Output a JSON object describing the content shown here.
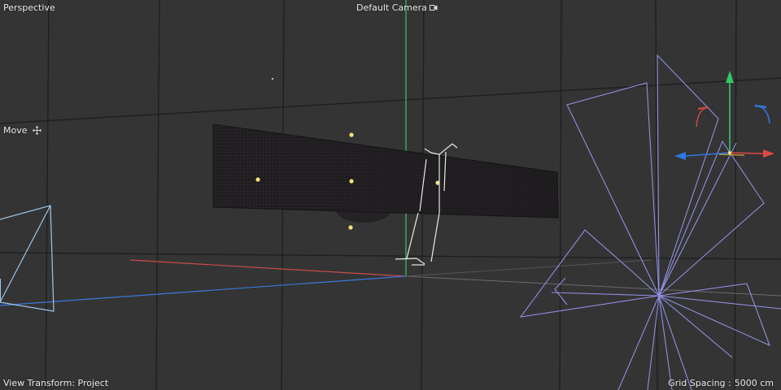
{
  "viewport": {
    "view_name": "Perspective",
    "camera": {
      "label": "Default Camera",
      "icon": "camera-switch-icon"
    },
    "active_tool": {
      "label": "Move",
      "icon": "move-icon"
    },
    "status": {
      "view_transform_label": "View Transform:",
      "view_transform_value": "Project",
      "grid_spacing_label": "Grid Spacing :",
      "grid_spacing_value": "5000 cm"
    }
  },
  "colors": {
    "background": "#343434",
    "grid_line": "#1f1f1f",
    "axis_x": "#c94a4a",
    "axis_y": "#3cc46e",
    "axis_z": "#3a78d8",
    "camera_wire": "#8f8fe0",
    "light_wire": "#9fc6e6",
    "skeleton": "#e8e8e8",
    "plane_mesh": "#1e1c1e",
    "handle": "#f2e27a",
    "gizmo_x": "#e04848",
    "gizmo_y": "#33c76a",
    "gizmo_z": "#2f78e0"
  }
}
